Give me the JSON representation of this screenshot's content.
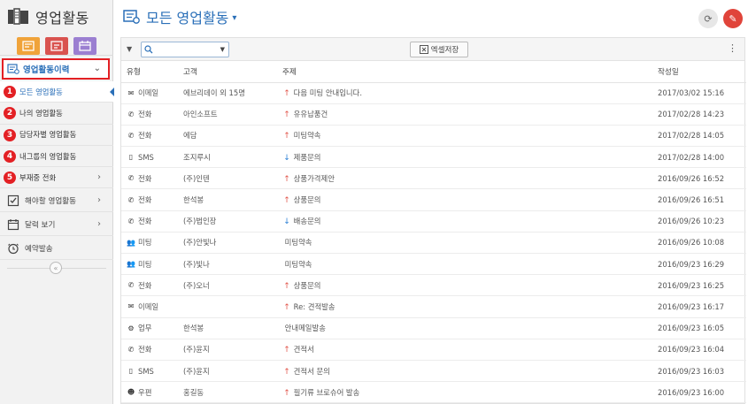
{
  "brand": {
    "title": "영업활동"
  },
  "quick_buttons": [
    {
      "icon": "activity-icon",
      "color": "#f0a33a"
    },
    {
      "icon": "contact-card-icon",
      "color": "#d9534f"
    },
    {
      "icon": "calendar-icon",
      "color": "#9b7fd1"
    }
  ],
  "sidebar": {
    "menu_head": "영업활동이력",
    "items": [
      {
        "badge": "1",
        "label": "모든 영업활동",
        "active": true
      },
      {
        "badge": "2",
        "label": "나의 영업활동",
        "active": false
      },
      {
        "badge": "3",
        "label": "담당자별 영업활동",
        "active": false
      },
      {
        "badge": "4",
        "label": "내그룹의 영업활동",
        "active": false
      },
      {
        "badge": "5",
        "label": "부재중 전화",
        "active": false,
        "chevron": "›"
      }
    ],
    "sections": [
      {
        "label": "해야할 영업활동",
        "icon": "checkbox-icon"
      },
      {
        "label": "달력 보기",
        "icon": "calendar-icon"
      },
      {
        "label": "예약발송",
        "icon": "clock-icon"
      }
    ],
    "collapse": "«"
  },
  "header": {
    "title": "모든 영업활동"
  },
  "toolbar": {
    "search_value": "",
    "excel_label": "엑셀저장"
  },
  "columns": {
    "type": "유형",
    "customer": "고객",
    "subject": "주제",
    "created": "작성일"
  },
  "rows": [
    {
      "type": "이메일",
      "type_icon": "✉",
      "customer": "에브리데이 외 15명",
      "arrow": "up",
      "subject": "다음 미팅 안내입니다.",
      "date": "2017/03/02 15:16"
    },
    {
      "type": "전화",
      "type_icon": "✆",
      "customer": "아인소프트",
      "arrow": "up",
      "subject": "유유납품건",
      "date": "2017/02/28 14:23"
    },
    {
      "type": "전화",
      "type_icon": "✆",
      "customer": "에담",
      "arrow": "up",
      "subject": "미팅약속",
      "date": "2017/02/28 14:05"
    },
    {
      "type": "SMS",
      "type_icon": "▯",
      "customer": "조지루시",
      "arrow": "down",
      "subject": "제품문의",
      "date": "2017/02/28 14:00"
    },
    {
      "type": "전화",
      "type_icon": "✆",
      "customer": "(주)인텐",
      "arrow": "up",
      "subject": "상품가격제안",
      "date": "2016/09/26 16:52"
    },
    {
      "type": "전화",
      "type_icon": "✆",
      "customer": "한석봉",
      "arrow": "up",
      "subject": "상품문의",
      "date": "2016/09/26 16:51"
    },
    {
      "type": "전화",
      "type_icon": "✆",
      "customer": "(주)법인장",
      "arrow": "down",
      "subject": "배송문의",
      "date": "2016/09/26 10:23"
    },
    {
      "type": "미팅",
      "type_icon": "👥",
      "customer": "(주)안빛나",
      "arrow": "none",
      "subject": "미팅약속",
      "date": "2016/09/26 10:08"
    },
    {
      "type": "미팅",
      "type_icon": "👥",
      "customer": "(주)빛나",
      "arrow": "none",
      "subject": "미팅약속",
      "date": "2016/09/23 16:29"
    },
    {
      "type": "전화",
      "type_icon": "✆",
      "customer": "(주)오너",
      "arrow": "up",
      "subject": "상품문의",
      "date": "2016/09/23 16:25"
    },
    {
      "type": "이메일",
      "type_icon": "✉",
      "customer": "",
      "arrow": "up",
      "subject": "Re: 견적발송",
      "date": "2016/09/23 16:17"
    },
    {
      "type": "업무",
      "type_icon": "⚙",
      "customer": "한석봉",
      "arrow": "none",
      "subject": "안내메일발송",
      "date": "2016/09/23 16:05"
    },
    {
      "type": "전화",
      "type_icon": "✆",
      "customer": "(주)윤지",
      "arrow": "up",
      "subject": "견적서",
      "date": "2016/09/23 16:04"
    },
    {
      "type": "SMS",
      "type_icon": "▯",
      "customer": "(주)윤지",
      "arrow": "up",
      "subject": "견적서 문의",
      "date": "2016/09/23 16:03"
    },
    {
      "type": "우편",
      "type_icon": "☻",
      "customer": "홍길동",
      "arrow": "up",
      "subject": "필기류 브로슈어 발송",
      "date": "2016/09/23 16:00"
    }
  ],
  "colors": {
    "accent": "#2a6fb8",
    "highlight": "#e32024",
    "edit": "#e0443a"
  }
}
